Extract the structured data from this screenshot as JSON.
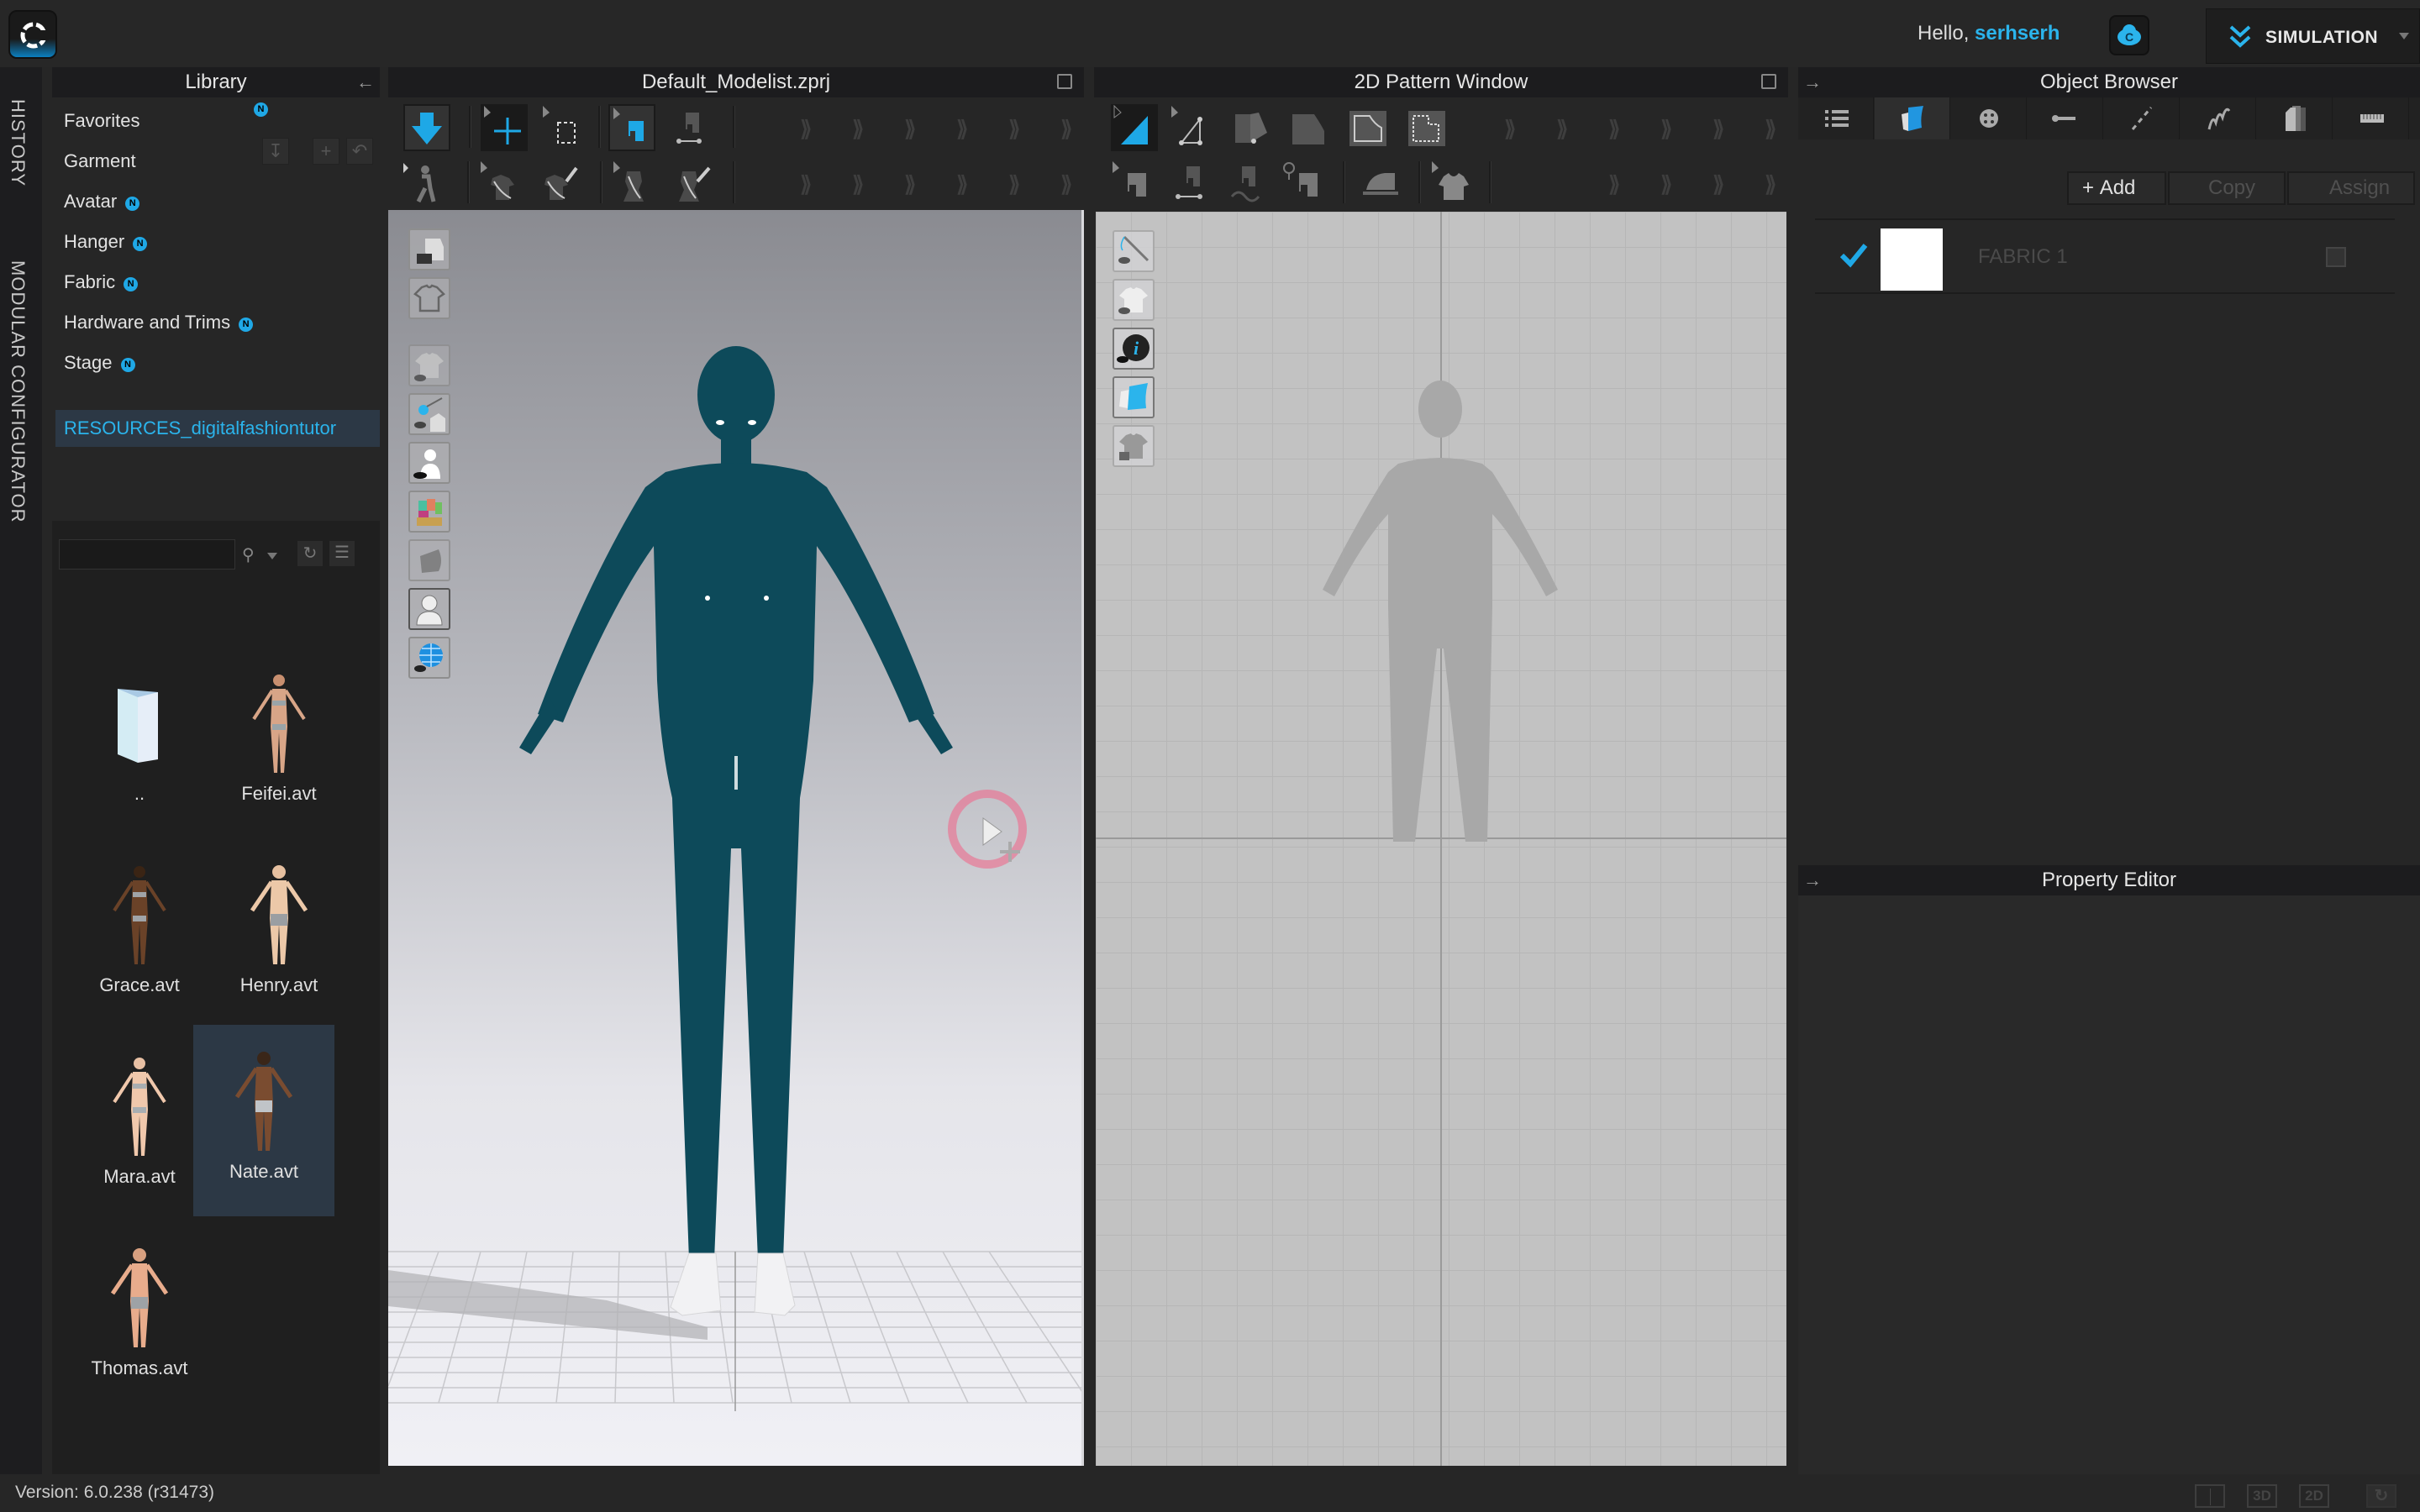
{
  "topbar": {
    "greeting": "Hello,",
    "username": "serhserh",
    "mode_label": "SIMULATION"
  },
  "side_tabs": [
    "HISTORY",
    "MODULAR CONFIGURATOR"
  ],
  "library": {
    "title": "Library",
    "categories": [
      {
        "label": "Favorites",
        "new": false
      },
      {
        "label": "Garment",
        "new": false
      },
      {
        "label": "Avatar",
        "new": true
      },
      {
        "label": "Hanger",
        "new": true
      },
      {
        "label": "Fabric",
        "new": true
      },
      {
        "label": "Hardware and Trims",
        "new": true
      },
      {
        "label": "Stage",
        "new": true
      },
      {
        "label": "RESOURCES_digitalfashiontutor",
        "new": false,
        "selected": true
      }
    ],
    "badge_text": "N",
    "search": {
      "value": "",
      "placeholder": ""
    },
    "files": [
      {
        "name": "..",
        "type": "folder"
      },
      {
        "name": "Feifei.avt",
        "type": "avatar"
      },
      {
        "name": "Grace.avt",
        "type": "avatar"
      },
      {
        "name": "Henry.avt",
        "type": "avatar"
      },
      {
        "name": "Mara.avt",
        "type": "avatar"
      },
      {
        "name": "Nate.avt",
        "type": "avatar",
        "selected": true
      },
      {
        "name": "Thomas.avt",
        "type": "avatar"
      }
    ]
  },
  "window3d": {
    "title": "Default_Modelist.zprj",
    "avatar_color": "#0d4a5a"
  },
  "window2d": {
    "title": "2D Pattern Window"
  },
  "object_browser": {
    "title": "Object Browser",
    "tabs": [
      "list",
      "fabric",
      "button",
      "buttonhole",
      "topstitch",
      "zipper",
      "pattern-pieces",
      "measure"
    ],
    "active_tab": 1,
    "buttons": {
      "add": "Add",
      "copy": "Copy",
      "assign": "Assign"
    },
    "fabrics": [
      {
        "name": "FABRIC 1",
        "checked": true,
        "swatch": "#ffffff"
      }
    ]
  },
  "property_editor": {
    "title": "Property Editor"
  },
  "status": {
    "version": "Version: 6.0.238 (r31473)",
    "view_buttons": [
      "split",
      "3D",
      "2D"
    ]
  },
  "colors": {
    "accent": "#2bb4ec",
    "selection": "#2c3845"
  }
}
